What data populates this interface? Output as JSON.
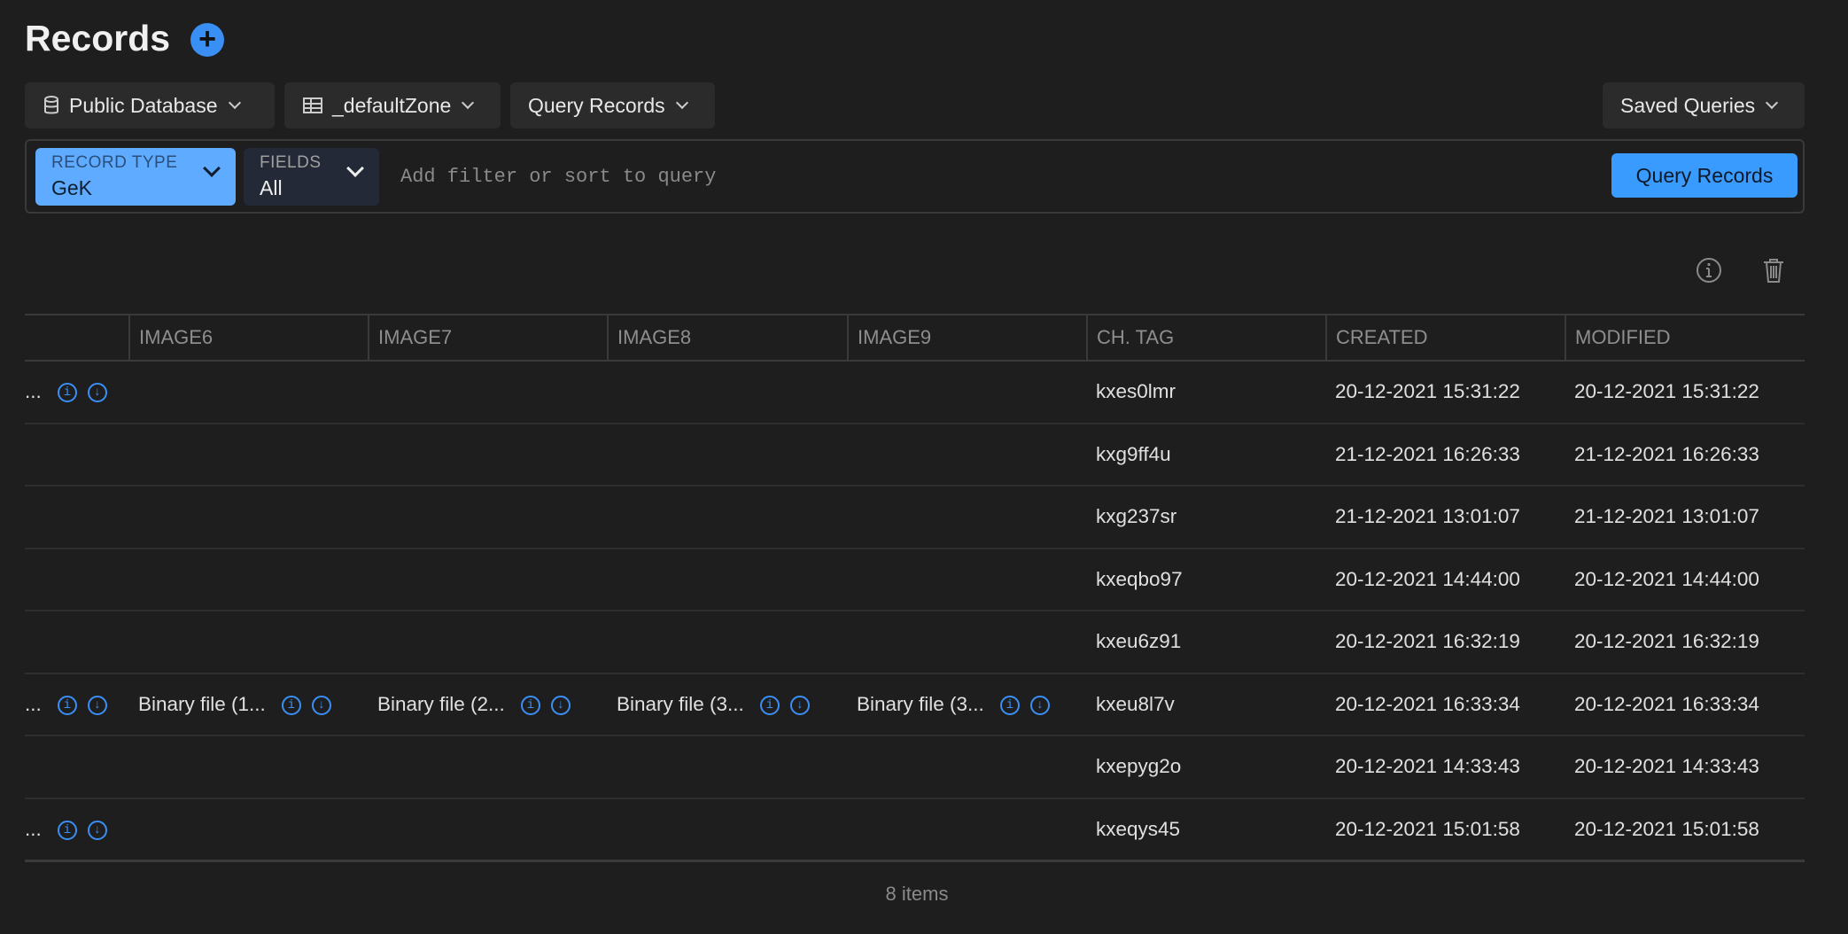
{
  "header": {
    "title": "Records",
    "add_icon": "plus-circle-icon"
  },
  "toolbar": {
    "database": "Public Database",
    "zone": "_defaultZone",
    "query": "Query Records",
    "saved": "Saved Queries"
  },
  "filter": {
    "record_type_label": "RECORD TYPE",
    "record_type_value": "GeK",
    "fields_label": "FIELDS",
    "fields_value": "All",
    "placeholder": "Add filter or sort to query",
    "submit": "Query Records"
  },
  "colors": {
    "accent": "#3a8ff5",
    "button": "#3a9bff",
    "pill": "#5eabff"
  },
  "table": {
    "columns": [
      "",
      "IMAGE6",
      "IMAGE7",
      "IMAGE8",
      "IMAGE9",
      "CH. TAG",
      "CREATED",
      "MODIFIED"
    ],
    "rows": [
      {
        "first": "...",
        "has_asset": true,
        "images": [
          "",
          "",
          "",
          ""
        ],
        "tag": "kxes0lmr",
        "created": "20-12-2021 15:31:22",
        "modified": "20-12-2021 15:31:22"
      },
      {
        "first": "",
        "has_asset": false,
        "images": [
          "",
          "",
          "",
          ""
        ],
        "tag": "kxg9ff4u",
        "created": "21-12-2021 16:26:33",
        "modified": "21-12-2021 16:26:33"
      },
      {
        "first": "",
        "has_asset": false,
        "images": [
          "",
          "",
          "",
          ""
        ],
        "tag": "kxg237sr",
        "created": "21-12-2021 13:01:07",
        "modified": "21-12-2021 13:01:07"
      },
      {
        "first": "",
        "has_asset": false,
        "images": [
          "",
          "",
          "",
          ""
        ],
        "tag": "kxeqbo97",
        "created": "20-12-2021 14:44:00",
        "modified": "20-12-2021 14:44:00"
      },
      {
        "first": "",
        "has_asset": false,
        "images": [
          "",
          "",
          "",
          ""
        ],
        "tag": "kxeu6z91",
        "created": "20-12-2021 16:32:19",
        "modified": "20-12-2021 16:32:19"
      },
      {
        "first": "...",
        "has_asset": true,
        "images": [
          "Binary file (1...",
          "Binary file (2...",
          "Binary file (3...",
          "Binary file (3..."
        ],
        "tag": "kxeu8l7v",
        "created": "20-12-2021 16:33:34",
        "modified": "20-12-2021 16:33:34"
      },
      {
        "first": "",
        "has_asset": false,
        "images": [
          "",
          "",
          "",
          ""
        ],
        "tag": "kxepyg2o",
        "created": "20-12-2021 14:33:43",
        "modified": "20-12-2021 14:33:43"
      },
      {
        "first": "...",
        "has_asset": true,
        "images": [
          "",
          "",
          "",
          ""
        ],
        "tag": "kxeqys45",
        "created": "20-12-2021 15:01:58",
        "modified": "20-12-2021 15:01:58"
      }
    ]
  },
  "footer": {
    "count": "8 items"
  }
}
